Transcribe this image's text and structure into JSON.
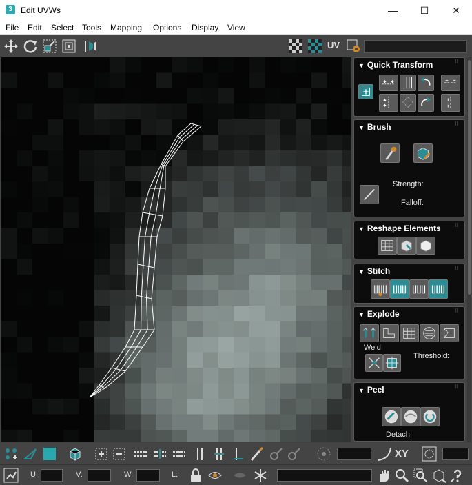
{
  "window": {
    "app_icon": "3",
    "title": "Edit UVWs",
    "minimize": "—",
    "maximize": "☐",
    "close": "✕"
  },
  "menu": [
    "File",
    "Edit",
    "Select",
    "Tools",
    "Mapping",
    "Options",
    "Display",
    "View"
  ],
  "toolbar": {
    "uv_label": "UV"
  },
  "rollouts": {
    "quick_transform": "Quick Transform",
    "brush": "Brush",
    "brush_strength_label": "Strength:",
    "brush_falloff_label": "Falloff:",
    "reshape": "Reshape Elements",
    "stitch": "Stitch",
    "explode": "Explode",
    "weld_label": "Weld",
    "threshold_label": "Threshold:",
    "peel": "Peel",
    "detach_label": "Detach"
  },
  "bottom": {
    "xy_label": "XY",
    "u_label": "U:",
    "v_label": "V:",
    "w_label": "W:",
    "l_label": "L:"
  },
  "colors": {
    "accent_teal": "#2a8d94",
    "panel_bg": "#444444",
    "rollout_bg": "#0c0c0c"
  }
}
